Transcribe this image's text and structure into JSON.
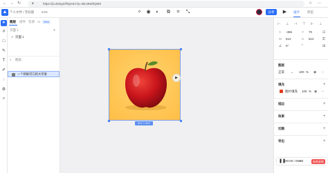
{
  "browser": {
    "url": "https://js.design/f/0pnSo?p=rBnJ5W0Q0M",
    "back_icon": "back-arrow-icon",
    "reload_icon": "reload-icon",
    "more_icon": "more-icon"
  },
  "toolbar": {
    "breadcrumb": "个人文件 / 无标题",
    "zoom": "64%",
    "share_label": "分享",
    "tabs": [
      {
        "label": "设计",
        "active": true
      },
      {
        "label": "原型",
        "active": false
      }
    ],
    "accent": "#2b6ef6"
  },
  "layers_panel": {
    "tabs": [
      {
        "label": "图层",
        "active": true
      },
      {
        "label": "组件",
        "active": false
      },
      {
        "label": "资源",
        "active": false
      },
      {
        "label": "AI",
        "active": false
      }
    ],
    "new_badge": "New",
    "pages_label": "页面 1",
    "page_item": "页面 1",
    "layers_label": "图层",
    "layer_item": "一个新鲜可口的大苹果"
  },
  "canvas": {
    "frame_size_label": "512 × 512",
    "background": "#ffc85a"
  },
  "properties": {
    "x_label": "X",
    "x_value": "-456",
    "y_label": "Y",
    "y_value": "70",
    "w_label": "W",
    "w_value": "512",
    "h_label": "H",
    "h_value": "512",
    "rotation_value": "0°",
    "layer_section": "图层",
    "blend_mode": "正常",
    "opacity": "100",
    "opacity_unit": "%",
    "fill_section": "填充",
    "fill_type": "图片填充",
    "fill_opacity": "100",
    "stroke_section": "描边",
    "effects_section": "效果",
    "slice_section": "切图",
    "export_section": "导出"
  },
  "player": {
    "time": "00:00 / 05:00",
    "stop_label": "结束录制"
  }
}
